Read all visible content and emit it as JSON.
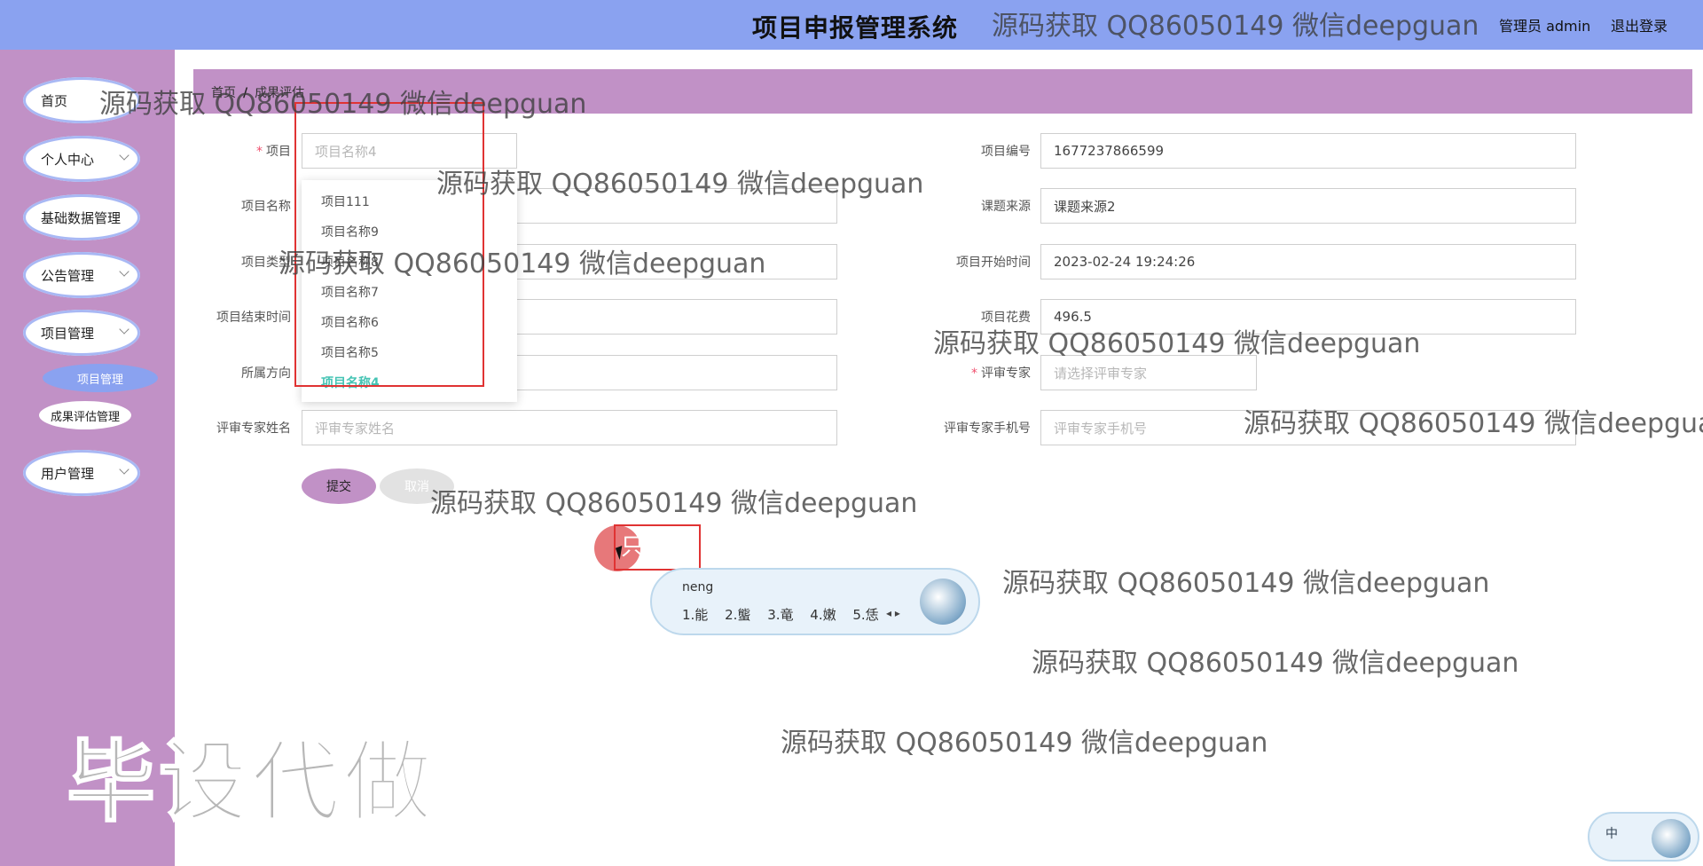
{
  "header": {
    "title": "项目申报管理系统",
    "user_label": "管理员 admin",
    "logout_label": "退出登录"
  },
  "sidebar": {
    "items": [
      {
        "label": "首页"
      },
      {
        "label": "个人中心"
      },
      {
        "label": "基础数据管理"
      },
      {
        "label": "公告管理"
      },
      {
        "label": "项目管理"
      },
      {
        "label": "用户管理"
      }
    ],
    "sub_items": [
      {
        "label": "项目管理"
      },
      {
        "label": "成果评估管理"
      }
    ]
  },
  "breadcrumb": {
    "home": "首页",
    "separator": "/",
    "current": "成果评估"
  },
  "form": {
    "left": [
      {
        "label": "项目",
        "required": true,
        "value": "",
        "placeholder": "项目名称4"
      },
      {
        "label": "项目名称",
        "value": ""
      },
      {
        "label": "项目类型",
        "value": ""
      },
      {
        "label": "项目结束时间",
        "value": ""
      },
      {
        "label": "所属方向",
        "value": ""
      },
      {
        "label": "评审专家姓名",
        "value": "",
        "placeholder": "评审专家姓名"
      }
    ],
    "right": [
      {
        "label": "项目编号",
        "value": "1677237866599"
      },
      {
        "label": "课题来源",
        "value": "课题来源2"
      },
      {
        "label": "项目开始时间",
        "value": "2023-02-24 19:24:26"
      },
      {
        "label": "项目花费",
        "value": "496.5"
      },
      {
        "label": "评审专家",
        "required": true,
        "value": "",
        "placeholder": "请选择评审专家"
      },
      {
        "label": "评审专家手机号",
        "value": "",
        "placeholder": "评审专家手机号"
      }
    ],
    "submit_label": "提交",
    "cancel_label": "取消"
  },
  "dropdown": {
    "options": [
      "项目111",
      "项目名称9",
      "项目名称8",
      "项目名称7",
      "项目名称6",
      "项目名称5",
      "项目名称4"
    ],
    "selected": "项目名称4"
  },
  "ime": {
    "floating_char": "只",
    "composition": "neng",
    "candidates": [
      "1.能",
      "2.螚",
      "3.竜",
      "4.嫩",
      "5.恁"
    ],
    "mode_label": "中"
  },
  "watermarks": {
    "text": "源码获取 QQ86050149 微信deepguan",
    "text_clipped": "源码获取 QQ86050149 微信deepgua",
    "big": "毕设代做"
  },
  "colors": {
    "header_bg": "#8aa2f0",
    "sidebar_bg": "#c191c6",
    "selected_option": "#46c4b4",
    "highlight_box": "#e03333"
  }
}
